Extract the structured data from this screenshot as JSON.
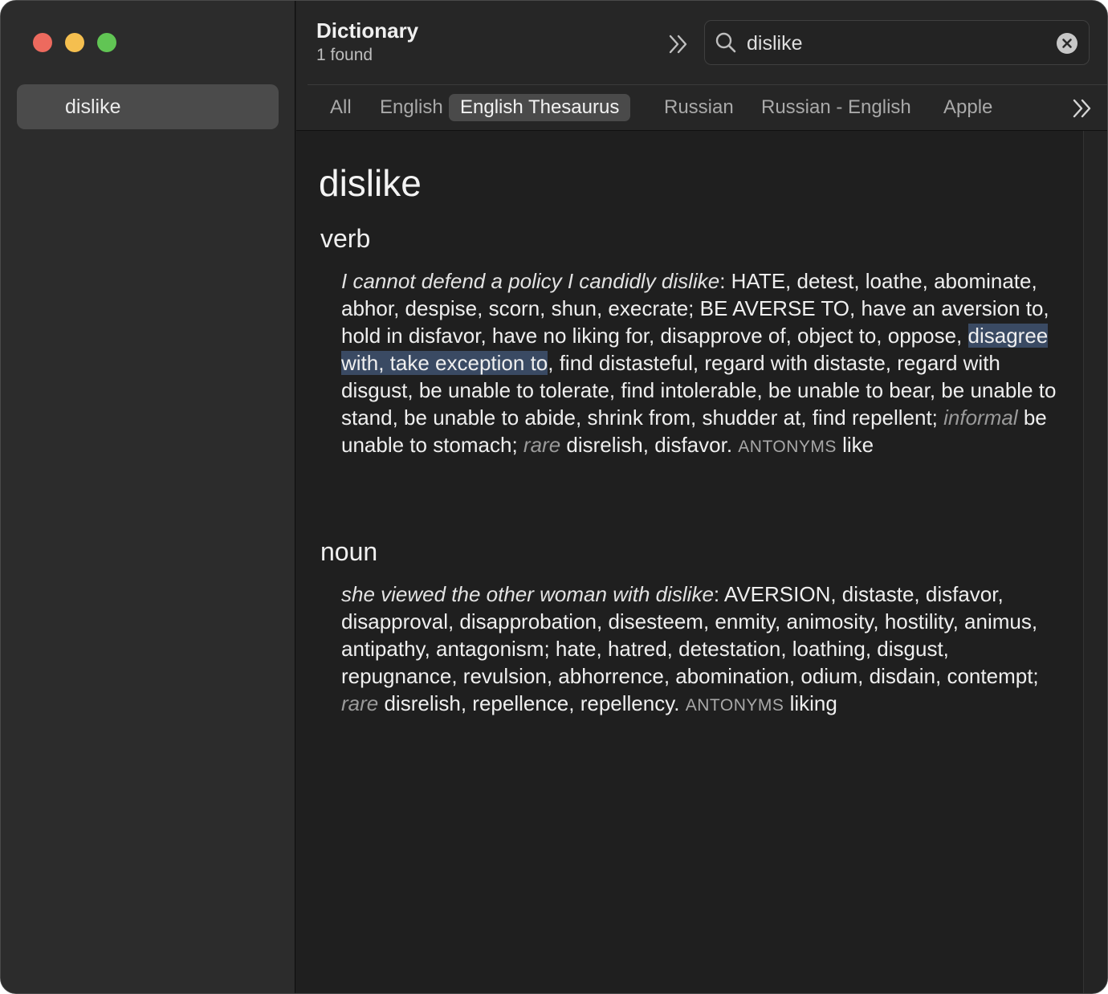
{
  "sidebar": {
    "items": [
      {
        "label": "dislike"
      }
    ]
  },
  "toolbar": {
    "title": "Dictionary",
    "found": "1 found"
  },
  "search": {
    "value": "dislike"
  },
  "tabs": [
    {
      "label": "All"
    },
    {
      "label": "English"
    },
    {
      "label": "English Thesaurus"
    },
    {
      "label": "Russian"
    },
    {
      "label": "Russian - English"
    },
    {
      "label": "Apple"
    }
  ],
  "entry": {
    "headword": "dislike",
    "verb": {
      "pos": "verb",
      "example": "I cannot defend a policy I candidly dislike",
      "colon": ": ",
      "core1": "HATE, detest, loathe,",
      "list1": " abominate, abhor, despise, scorn, shun, execrate; ",
      "core2": "BE AVERSE TO",
      "list2": ", have an aversion to, hold in disfavor, have no liking for, disapprove of, object to, oppose, ",
      "highlight": "disagree with, take exception to",
      "list3": ", find distasteful, regard with distaste, regard with disgust, be unable to tolerate, find intolerable, be unable to bear, be unable to stand, be unable to abide, shrink from, shudder at, find repellent; ",
      "register1": "informal",
      "list4": " be unable to stomach; ",
      "register2": "rare",
      "list5": " disrelish, disfavor. ",
      "antonyms_label": "ANTONYMS",
      "antonym": " like"
    },
    "noun": {
      "pos": "noun",
      "example": "she viewed the other woman with dislike",
      "colon": ": ",
      "core1": "AVERSION",
      "list1": ", distaste, disfavor, disapproval, disapprobation, disesteem, enmity, animosity, hostility, animus, antipathy, antagonism; hate, hatred, detestation, loathing, disgust, repugnance, revulsion, abhorrence, abomination, odium, disdain, contempt; ",
      "register1": "rare",
      "list2": " disrelish, repellence, repellency. ",
      "antonyms_label": "ANTONYMS",
      "antonym": " liking"
    }
  }
}
